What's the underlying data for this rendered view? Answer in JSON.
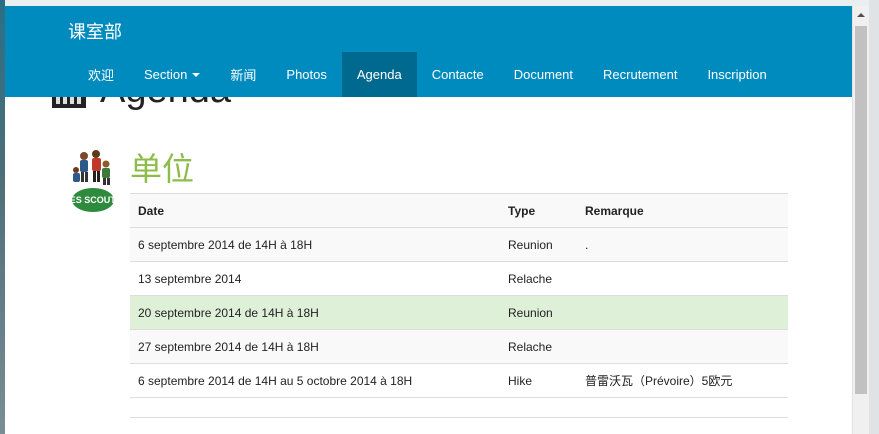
{
  "brand": "课室部",
  "nav": {
    "items": [
      {
        "label": "欢迎",
        "active": false
      },
      {
        "label": "Section",
        "active": false,
        "dropdown": true
      },
      {
        "label": "新闻",
        "active": false
      },
      {
        "label": "Photos",
        "active": false
      },
      {
        "label": "Agenda",
        "active": true
      },
      {
        "label": "Contacte",
        "active": false
      },
      {
        "label": "Document",
        "active": false
      },
      {
        "label": "Recrutement",
        "active": false
      },
      {
        "label": "Inscription",
        "active": false
      }
    ]
  },
  "page": {
    "heading": "Agenda",
    "heading_icon": "calendar-icon"
  },
  "unit": {
    "title": "单位",
    "logo_text": "LES SCOUTS"
  },
  "table": {
    "headers": [
      "Date",
      "Type",
      "Remarque"
    ],
    "rows": [
      {
        "date": "6 septembre 2014 de 14H à 18H",
        "type": "Reunion",
        "remark": ".",
        "style": "odd"
      },
      {
        "date": "13 septembre 2014",
        "type": "Relache",
        "remark": "",
        "style": "even"
      },
      {
        "date": "20 septembre 2014 de 14H à 18H",
        "type": "Reunion",
        "remark": "",
        "style": "success"
      },
      {
        "date": "27 septembre 2014 de 14H à 18H",
        "type": "Relache",
        "remark": "",
        "style": "odd"
      },
      {
        "date": "6 septembre 2014 de 14H au 5 octobre 2014 à 18H",
        "type": "Hike",
        "remark": "普雷沃瓦（Prévoire）5欧元",
        "style": "even"
      }
    ]
  },
  "colors": {
    "navbar": "#008bbf",
    "nav_active": "#00698f",
    "unit_title": "#8cbc4a",
    "success_row": "#dff0d8"
  }
}
